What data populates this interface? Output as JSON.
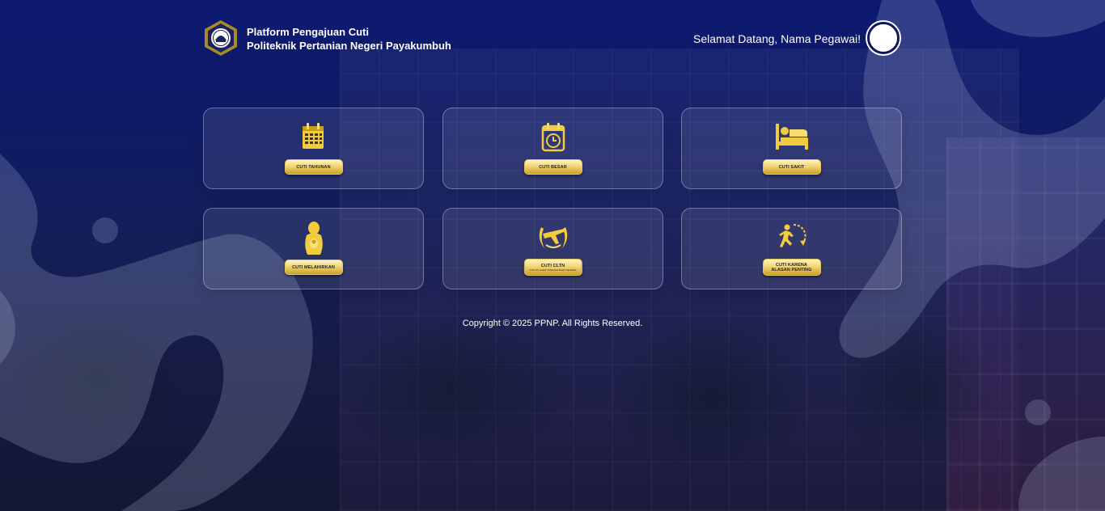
{
  "header": {
    "title_line1": "Platform Pengajuan Cuti",
    "title_line2": "Politeknik Pertanian Negeri Payakumbuh",
    "welcome": "Selamat Datang, Nama Pegawai!"
  },
  "menu": [
    {
      "label": "CUTI TAHUNAN",
      "icon": "calendar-icon"
    },
    {
      "label": "CUTI BESAR",
      "icon": "calendar-clock-icon"
    },
    {
      "label": "CUTI SAKIT",
      "icon": "bed-icon"
    },
    {
      "label": "CUTI MELAHIRKAN",
      "icon": "mother-baby-icon"
    },
    {
      "label": "CUTI CLTN",
      "sublabel": "Cuti di Luar Tanggungan Negara",
      "icon": "plane-wreath-icon"
    },
    {
      "label": "CUTI KARENA",
      "label2": "ALASAN PENTING",
      "icon": "running-person-icon"
    }
  ],
  "footer": {
    "copyright": "Copyright © 2025 PPNP. All Rights Reserved."
  },
  "colors": {
    "background": "#0d1a5e",
    "icon_gold": "#f2cc3c",
    "pill_gold": "#f2d674"
  }
}
